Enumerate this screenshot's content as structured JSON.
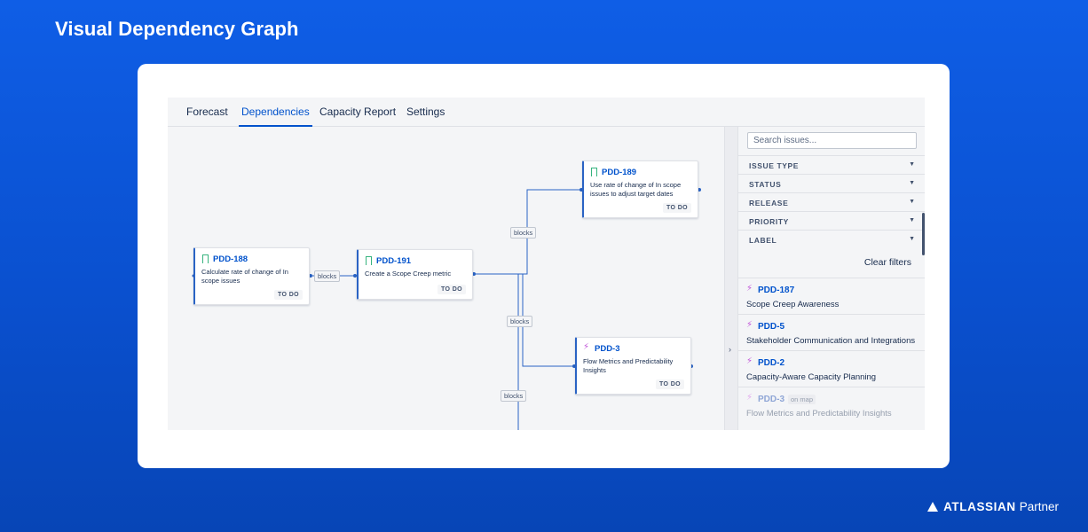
{
  "page_title": "Visual Dependency Graph",
  "tabs": [
    {
      "label": "Forecast"
    },
    {
      "label": "Dependencies"
    },
    {
      "label": "Capacity Report"
    },
    {
      "label": "Settings"
    }
  ],
  "graph": {
    "edge_label": "blocks",
    "nodes": [
      {
        "key": "PDD-188",
        "icon": "bookmark-icon",
        "summary": "Calculate rate of change of In scope issues",
        "status": "TO DO"
      },
      {
        "key": "PDD-191",
        "icon": "bookmark-icon",
        "summary": "Create a Scope Creep metric",
        "status": "TO DO"
      },
      {
        "key": "PDD-189",
        "icon": "bookmark-icon",
        "summary": "Use rate of change of In scope issues to adjust target dates",
        "status": "TO DO"
      },
      {
        "key": "PDD-3",
        "icon": "lightning-icon",
        "summary": "Flow Metrics and Predictability Insights",
        "status": "TO DO"
      }
    ]
  },
  "panel": {
    "search_placeholder": "Search issues...",
    "filters": [
      {
        "label": "ISSUE TYPE"
      },
      {
        "label": "STATUS"
      },
      {
        "label": "RELEASE"
      },
      {
        "label": "PRIORITY"
      },
      {
        "label": "LABEL"
      }
    ],
    "clear_filters": "Clear filters",
    "issues": [
      {
        "key": "PDD-187",
        "title": "Scope Creep Awareness"
      },
      {
        "key": "PDD-5",
        "title": "Stakeholder Communication and Integrations"
      },
      {
        "key": "PDD-2",
        "title": "Capacity-Aware Capacity Planning"
      },
      {
        "key": "PDD-3",
        "title": "Flow Metrics and Predictability Insights",
        "badge": "on map"
      }
    ]
  },
  "footer": {
    "brand": "ATLASSIAN",
    "suffix": "Partner"
  },
  "colors": {
    "background": "#0a50cf",
    "accent": "#0052cc",
    "edge": "#2a63c4",
    "epic_icon": "#c054d9"
  }
}
